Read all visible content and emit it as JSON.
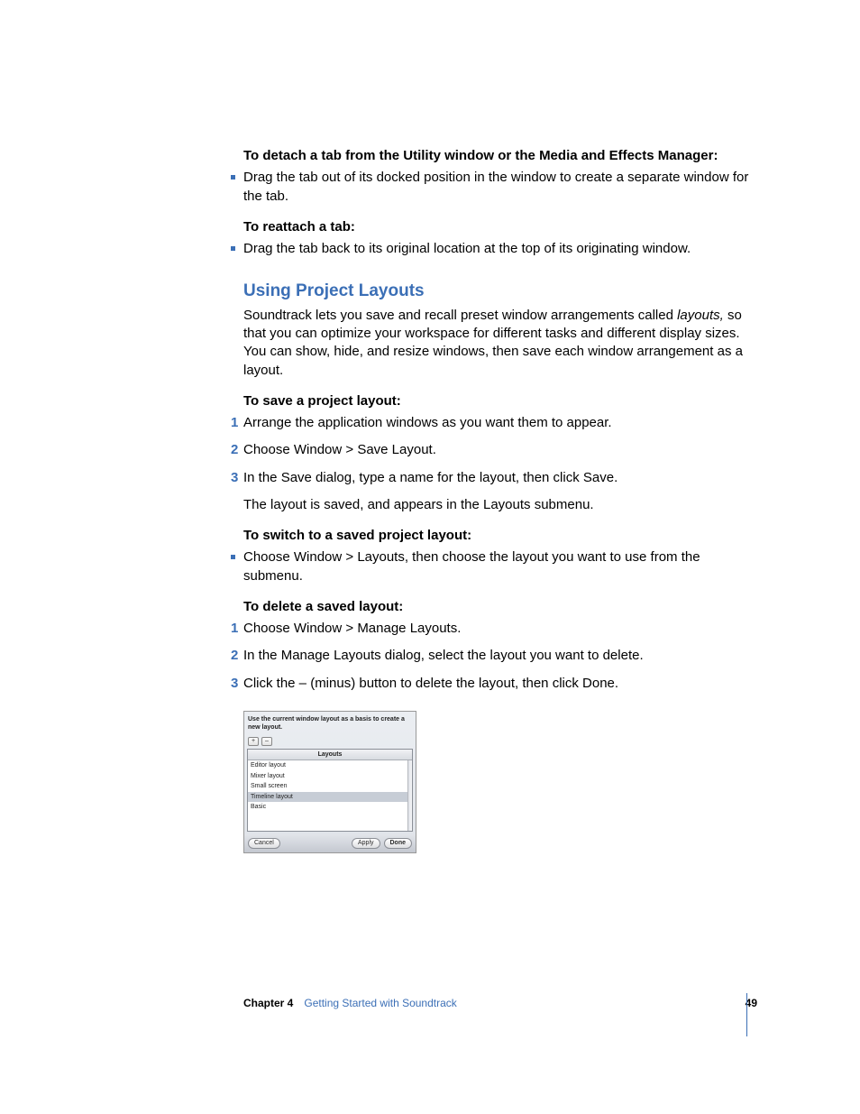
{
  "headings": {
    "detach": "To detach a tab from the Utility window or the Media and Effects Manager:",
    "reattach": "To reattach a tab:",
    "save_layout": "To save a project layout:",
    "switch_layout": "To switch to a saved project layout:",
    "delete_layout": "To delete a saved layout:"
  },
  "bullets": {
    "detach": "Drag the tab out of its docked position in the window to create a separate window for the tab.",
    "reattach": "Drag the tab back to its original location at the top of its originating window.",
    "switch": "Choose Window > Layouts, then choose the layout you want to use from the submenu."
  },
  "section": {
    "title": "Using Project Layouts",
    "intro_a": "Soundtrack lets you save and recall preset window arrangements called ",
    "intro_italic": "layouts,",
    "intro_b": " so that you can optimize your workspace for different tasks and different display sizes. You can show, hide, and resize windows, then save each window arrangement as a layout."
  },
  "save_steps": [
    "Arrange the application windows as you want them to appear.",
    "Choose Window > Save Layout.",
    "In the Save dialog, type a name for the layout, then click Save."
  ],
  "save_result": "The layout is saved, and appears in the Layouts submenu.",
  "delete_steps": [
    "Choose Window > Manage Layouts.",
    "In the Manage Layouts dialog, select the layout you want to delete.",
    "Click the – (minus) button to delete the layout, then click Done."
  ],
  "dialog": {
    "instruction": "Use the current window layout as a basis to create a new layout.",
    "plus": "+",
    "minus": "–",
    "header": "Layouts",
    "rows": [
      "Editor layout",
      "Mixer layout",
      "Small screen",
      "Timeline layout",
      "Basic"
    ],
    "selected_index": 3,
    "cancel": "Cancel",
    "apply": "Apply",
    "done": "Done"
  },
  "footer": {
    "chapter_label": "Chapter 4",
    "chapter_title": "Getting Started with Soundtrack",
    "page_number": "49"
  }
}
